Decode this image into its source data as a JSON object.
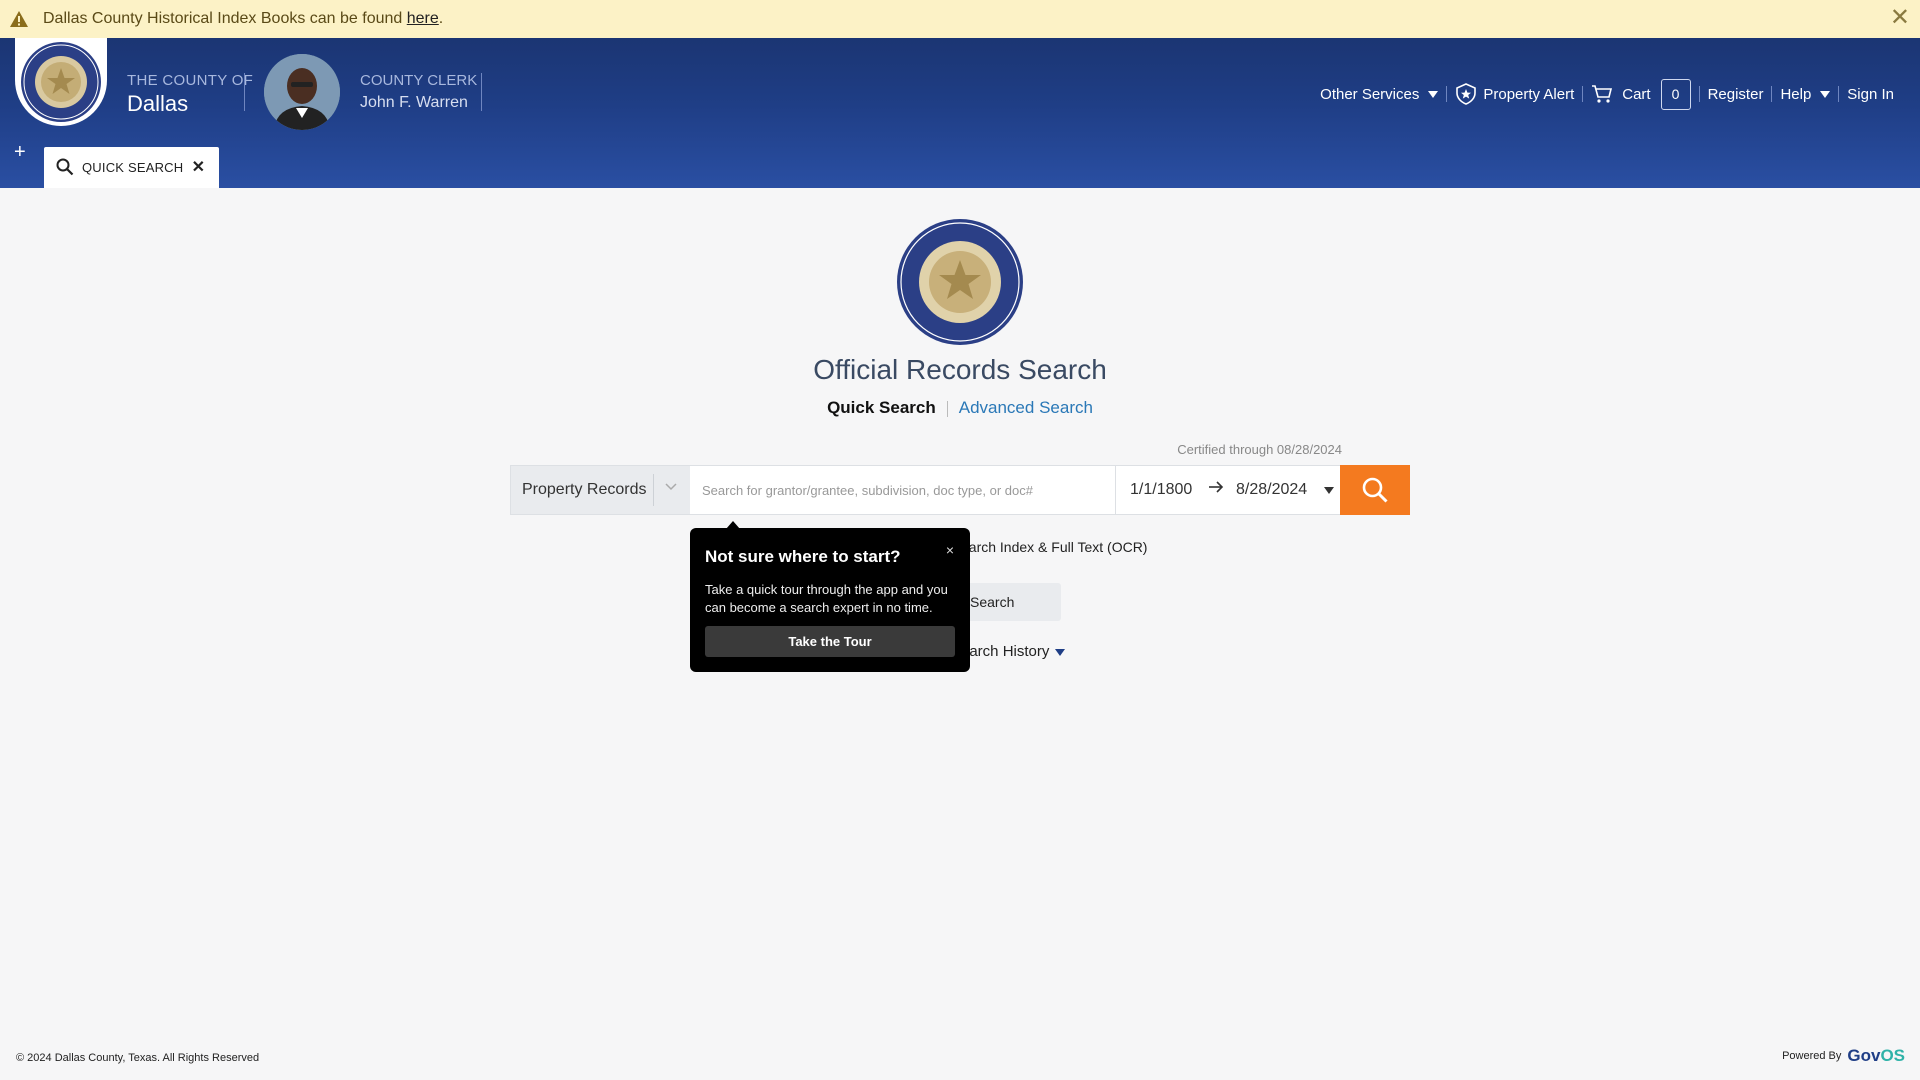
{
  "banner": {
    "message": "Dallas County Historical Index Books can be found ",
    "link_text": "here",
    "suffix": ".",
    "close_symbol": "✕"
  },
  "header": {
    "county_of": "THE COUNTY OF",
    "county_name": "Dallas",
    "clerk_title": "COUNTY CLERK",
    "clerk_name": "John F. Warren",
    "nav": {
      "other_services": "Other Services",
      "property_alert": "Property Alert",
      "cart": "Cart",
      "cart_count": "0",
      "register": "Register",
      "help": "Help",
      "sign_in": "Sign In"
    }
  },
  "tabs": {
    "add_symbol": "+",
    "items": [
      {
        "label": "QUICK SEARCH",
        "close_symbol": "✕"
      }
    ]
  },
  "main": {
    "title": "Official Records Search",
    "mode_active": "Quick Search",
    "mode_link": "Advanced Search",
    "certified": "Certified through 08/28/2024",
    "search": {
      "record_type": "Property Records",
      "placeholder": "Search for grantor/grantee, subdivision, doc type, or doc#",
      "date_from": "1/1/1800",
      "date_to": "8/28/2024"
    },
    "ocr_label": "earch Index & Full Text (OCR)",
    "secondary_button": "Search",
    "history_label": "earch History"
  },
  "popover": {
    "title": "Not sure where to start?",
    "body": "Take a quick tour through the app and you can become a search expert in no time.",
    "button": "Take the Tour",
    "close_symbol": "×"
  },
  "footer": {
    "copyright": "© 2024 Dallas County, Texas. All Rights Reserved",
    "powered_by": "Powered By",
    "brand_a": "Gov",
    "brand_b": "OS"
  },
  "colors": {
    "header_blue": "#1f3e86",
    "search_orange": "#f47a1f",
    "banner_yellow": "#fcf2c6",
    "link_blue": "#2a78b7"
  },
  "icons": {
    "banner": "warning-icon",
    "alert": "shield-star-icon",
    "cart": "cart-icon",
    "search": "search-icon"
  }
}
